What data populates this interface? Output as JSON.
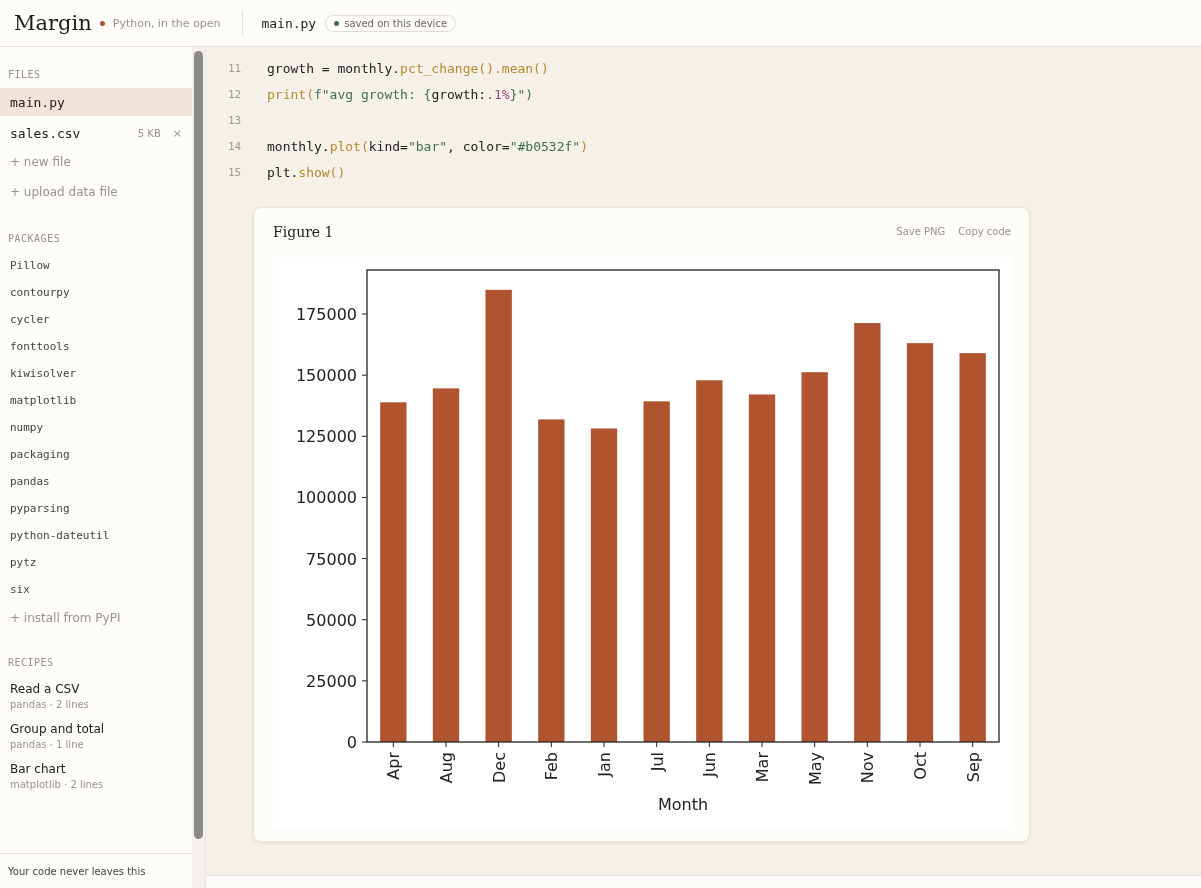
{
  "header": {
    "logo": "Margin",
    "tagline": "Python, in the open",
    "file_name": "main.py",
    "save_status": "saved on this device"
  },
  "sidebar": {
    "files_heading": "FILES",
    "files": [
      {
        "name": "main.py",
        "selected": true
      },
      {
        "name": "sales.csv",
        "size": "5 KB",
        "remove": "×",
        "selected": false
      }
    ],
    "file_actions": [
      "+ new file",
      "+ upload data file"
    ],
    "packages_heading": "PACKAGES",
    "packages": [
      "Pillow",
      "contourpy",
      "cycler",
      "fonttools",
      "kiwisolver",
      "matplotlib",
      "numpy",
      "packaging",
      "pandas",
      "pyparsing",
      "python-dateutil",
      "pytz",
      "six"
    ],
    "package_action": "+ install from PyPI",
    "recipes_heading": "RECIPES",
    "recipes": [
      {
        "title": "Read a CSV",
        "meta": "pandas · 2 lines"
      },
      {
        "title": "Group and total",
        "meta": "pandas · 1 line"
      },
      {
        "title": "Bar chart",
        "meta": "matplotlib · 2 lines"
      }
    ],
    "footer": "Your code never leaves this"
  },
  "editor": {
    "lines": [
      {
        "number": "11",
        "tokens": [
          {
            "text": "growth = monthly.",
            "kind": "plain"
          },
          {
            "text": "pct_change().mean()",
            "kind": "call"
          }
        ]
      },
      {
        "number": "12",
        "tokens": [
          {
            "text": "print(",
            "kind": "call"
          },
          {
            "text": "f\"avg growth: {",
            "kind": "string"
          },
          {
            "text": "growth:",
            "kind": "plain"
          },
          {
            "text": ".1%",
            "kind": "number"
          },
          {
            "text": "}\")",
            "kind": "string"
          }
        ]
      },
      {
        "number": "13"
      },
      {
        "number": "14",
        "tokens": [
          {
            "text": "monthly.",
            "kind": "plain"
          },
          {
            "text": "plot(",
            "kind": "call"
          },
          {
            "text": "kind=",
            "kind": "plain"
          },
          {
            "text": "\"bar\"",
            "kind": "string"
          },
          {
            "text": ", color=",
            "kind": "plain"
          },
          {
            "text": "\"#b0532f\"",
            "kind": "string"
          },
          {
            "text": ")",
            "kind": "call"
          }
        ]
      },
      {
        "number": "15",
        "tokens": [
          {
            "text": "plt.",
            "kind": "plain"
          },
          {
            "text": "show()",
            "kind": "call"
          }
        ]
      }
    ]
  },
  "figure": {
    "title": "Figure 1",
    "actions": [
      "Save PNG",
      "Copy code"
    ],
    "chart_data": {
      "type": "bar",
      "xlabel": "Month",
      "categories": [
        "Apr",
        "Aug",
        "Dec",
        "Feb",
        "Jan",
        "Jul",
        "Jun",
        "Mar",
        "May",
        "Nov",
        "Oct",
        "Sep"
      ],
      "series": [
        {
          "color": "#b0532f",
          "values": [
            138900,
            144600,
            184900,
            131900,
            128200,
            139300,
            147900,
            142100,
            151200,
            171300,
            163100,
            159000
          ]
        }
      ],
      "ylim": [
        0,
        193000
      ],
      "yticks": [
        0,
        25000,
        50000,
        75000,
        100000,
        125000,
        150000,
        175000
      ]
    }
  }
}
